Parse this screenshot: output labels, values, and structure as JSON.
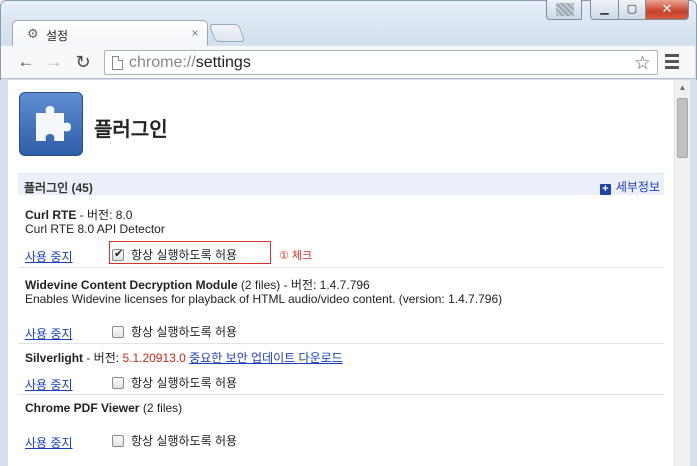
{
  "window": {
    "tab_title": "설정",
    "tab_icon": "gear-icon",
    "tab_close": "×",
    "controls": [
      "user-avatar",
      "minimize-icon",
      "maximize-icon",
      "close-icon"
    ]
  },
  "toolbar": {
    "url_scheme": "chrome://",
    "url_path": "settings"
  },
  "page": {
    "title": "플러그인",
    "section_title": "플러그인 (45)",
    "details_label": "세부정보"
  },
  "plugins": [
    {
      "name": "Curl RTE",
      "meta": " - 버전: 8.0",
      "description": "Curl RTE 8.0 API Detector",
      "disable_label": "사용 중지",
      "always_allow_label": "항상 실행하도록 허용",
      "always_allow_checked": true
    },
    {
      "name": "Widevine Content Decryption Module",
      "meta": " (2 files) - 버전: 1.4.7.796",
      "description": "Enables Widevine licenses for playback of HTML audio/video content. (version: 1.4.7.796)",
      "disable_label": "사용 중지",
      "always_allow_label": "항상 실행하도록 허용",
      "always_allow_checked": false
    },
    {
      "name": "Silverlight",
      "meta": " - 버전: ",
      "version_red": "5.1.20913.0",
      "update_link": "중요한 보안 업데이트 다운로드",
      "disable_label": "사용 중지",
      "always_allow_label": "항상 실행하도록 허용",
      "always_allow_checked": false
    },
    {
      "name": "Chrome PDF Viewer",
      "meta": " (2 files)",
      "disable_label": "사용 중지",
      "always_allow_label": "항상 실행하도록 허용",
      "always_allow_checked": false
    }
  ],
  "annotation": {
    "text": "① 체크",
    "color": "#d8322a"
  }
}
